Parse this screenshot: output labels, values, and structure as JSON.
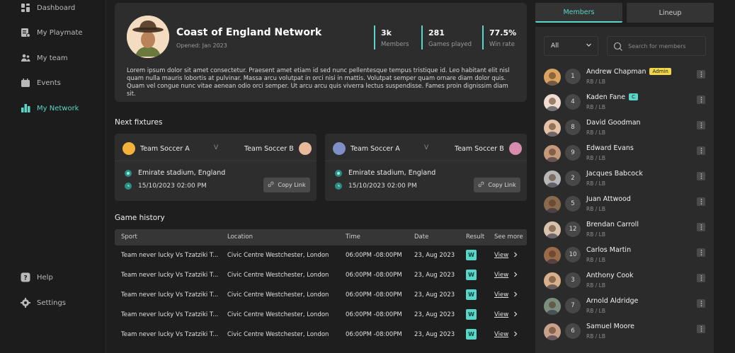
{
  "sidebar": {
    "items": [
      {
        "label": "Dashboard",
        "icon": "dashboard-icon"
      },
      {
        "label": "My Playmate",
        "icon": "playmate-icon"
      },
      {
        "label": "My team",
        "icon": "team-icon"
      },
      {
        "label": "Events",
        "icon": "calendar-icon"
      },
      {
        "label": "My Network",
        "icon": "network-icon",
        "active": true
      }
    ],
    "bottom": [
      {
        "label": "Help",
        "icon": "help-icon"
      },
      {
        "label": "Settings",
        "icon": "gear-icon"
      }
    ]
  },
  "org": {
    "name": "Coast of England Network",
    "opened": "Opened: Jan 2023",
    "stats": [
      {
        "value": "3k",
        "label": "Members"
      },
      {
        "value": "281",
        "label": "Games played"
      },
      {
        "value": "77.5%",
        "label": "Win rate"
      }
    ],
    "description": "Lorem ipsum dolor sit amet consectetur. Praesent amet etiam id sed nunc pellentesque tempus tristique id. Leo habitant elit nisl quam nulla mauris lobortis at pulvinar. Massa arcu volutpat in orci nisi in mattis. Volutpat semper quam ornare diam dolor quis. Quam vel congue nunc vitae aenean odio orci semper. Ut arcu arcu quis viverra lectus suspendisse. Fames proin dignissim diam sit."
  },
  "fixtures": {
    "title": "Next fixtures",
    "vs": "V",
    "copy_label": "Copy Link",
    "items": [
      {
        "home": "Team Soccer A",
        "away": "Team Soccer B",
        "location": "Emirate stadium, England",
        "datetime": "15/10/2023 02:00 PM"
      },
      {
        "home": "Team Soccer A",
        "away": "Team Soccer B",
        "location": "Emirate stadium, England",
        "datetime": "15/10/2023 02:00 PM"
      }
    ]
  },
  "history": {
    "title": "Game history",
    "headers": {
      "sport": "Sport",
      "location": "Location",
      "time": "Time",
      "date": "Date",
      "result": "Result",
      "more": "See more"
    },
    "view_label": "View",
    "rows": [
      {
        "sport": "Team never lucky Vs Tzatziki T...",
        "location": "Civic Centre Westchester, London",
        "time": "06:00PM -08:00PM",
        "date": "23, Aug 2023",
        "result": "W"
      },
      {
        "sport": "Team never lucky Vs Tzatziki T...",
        "location": "Civic Centre Westchester, London",
        "time": "06:00PM -08:00PM",
        "date": "23, Aug 2023",
        "result": "W"
      },
      {
        "sport": "Team never lucky Vs Tzatziki T...",
        "location": "Civic Centre Westchester, London",
        "time": "06:00PM -08:00PM",
        "date": "23, Aug 2023",
        "result": "W"
      },
      {
        "sport": "Team never lucky Vs Tzatziki T...",
        "location": "Civic Centre Westchester, London",
        "time": "06:00PM -08:00PM",
        "date": "23, Aug 2023",
        "result": "W"
      },
      {
        "sport": "Team never lucky Vs Tzatziki T...",
        "location": "Civic Centre Westchester, London",
        "time": "06:00PM -08:00PM",
        "date": "23, Aug 2023",
        "result": "W"
      }
    ]
  },
  "members_panel": {
    "tabs": [
      {
        "label": "Members",
        "active": true
      },
      {
        "label": "Lineup"
      }
    ],
    "filter_value": "All",
    "search_placeholder": "Search for members",
    "members": [
      {
        "number": "1",
        "name": "Andrew Chapman",
        "position": "RB / LB",
        "badge": "Admin",
        "badge_color": "#f1d54a"
      },
      {
        "number": "4",
        "name": "Kaden Fane",
        "position": "RB / LB",
        "badge": "C",
        "badge_color": "#5ad6c8"
      },
      {
        "number": "8",
        "name": "David Goodman",
        "position": "RB / LB"
      },
      {
        "number": "9",
        "name": "Edward Evans",
        "position": "RB / LB"
      },
      {
        "number": "2",
        "name": "Jacques Babcock",
        "position": "RB / LB"
      },
      {
        "number": "5",
        "name": "Juan Attwood",
        "position": "RB / LB"
      },
      {
        "number": "12",
        "name": "Brendan Carroll",
        "position": "RB / LB"
      },
      {
        "number": "10",
        "name": "Carlos Martin",
        "position": "RB / LB"
      },
      {
        "number": "3",
        "name": "Anthony Cook",
        "position": "RB / LB"
      },
      {
        "number": "7",
        "name": "Arnold Aldridge",
        "position": "RB / LB"
      },
      {
        "number": "6",
        "name": "Samuel Moore",
        "position": "RB / LB"
      }
    ]
  },
  "colors": {
    "accent": "#5ad6c8",
    "admin_badge": "#f1d54a"
  }
}
